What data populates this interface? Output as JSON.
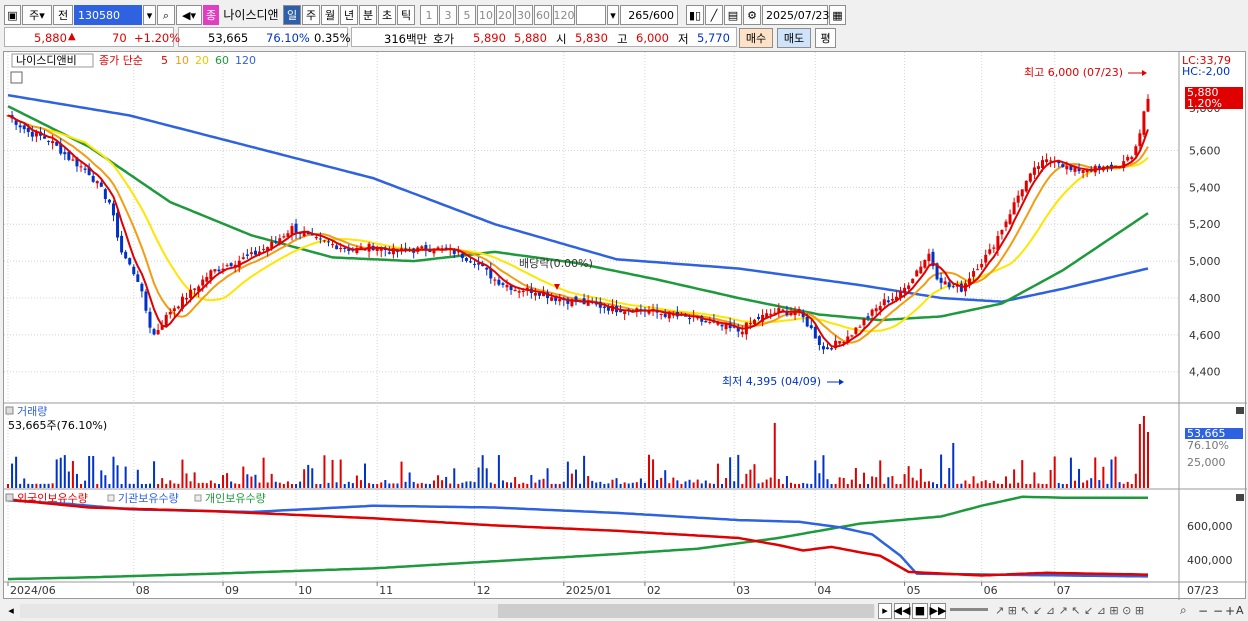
{
  "toolbar": {
    "type_select": "주",
    "mode_select": "전",
    "code": "130580",
    "stock_tag": "종",
    "stock_name": "나이스디앤",
    "periods": [
      "일",
      "주",
      "월",
      "년",
      "분",
      "초",
      "틱"
    ],
    "intervals": [
      "1",
      "3",
      "5",
      "10",
      "20",
      "30",
      "60",
      "120"
    ],
    "count": "265",
    "count_total": "/600",
    "date": "2025/07/23"
  },
  "info": {
    "price": "5,880",
    "arrow": "▲",
    "change": "70",
    "change_pct": "+1.20%",
    "volume": "53,665",
    "vol_ratio": "76.10%",
    "turnover": "0.35%",
    "amount": "316백만",
    "quote_label": "호가",
    "ask": "5,890",
    "bid": "5,880",
    "open_label": "시",
    "open": "5,830",
    "high_label": "고",
    "high": "6,000",
    "low_label": "저",
    "low": "5,770",
    "buy": "매수",
    "sell": "매도",
    "eval": "평"
  },
  "colors": {
    "up": "#e00000",
    "down": "#0032c8",
    "ma5": "#e00000",
    "ma10": "#f39c12",
    "ma20": "#ffe600",
    "ma60": "#1e9a3c",
    "ma120": "#2f62e0",
    "foreign": "#e00000",
    "inst": "#2f62e0",
    "indiv": "#1e9a3c"
  },
  "price_panel": {
    "name_label": "나이스디앤비",
    "legend_prefix": "종가 단순",
    "ma_periods": [
      "5",
      "10",
      "20",
      "60",
      "120"
    ],
    "lc": "LC:33,79",
    "hc": "HC:-2,00",
    "last_price": "5,880",
    "last_pct": "1.20%",
    "cut_label": "5,800",
    "high_note": "최고 6,000 (07/23)",
    "low_note": "최저 4,395 (04/09)",
    "dividend": "배당락(0.00%)"
  },
  "volume_panel": {
    "title": "거래량",
    "sub": "53,665주(76.10%)",
    "last": "53,665",
    "last_pct": "76.10%",
    "tick": "25,000"
  },
  "holdings_panel": {
    "foreign": "외국인보유수량",
    "inst": "기관보유수량",
    "indiv": "개인보유수량",
    "ticks": [
      "600,000",
      "400,000"
    ]
  },
  "x_axis": [
    "2024/06",
    "08",
    "09",
    "10",
    "11",
    "12",
    "2025/01",
    "02",
    "03",
    "04",
    "05",
    "06",
    "07"
  ],
  "x_axis_right": "07/23",
  "chart_data": {
    "type": "line",
    "y_ticks": [
      4400,
      4600,
      4800,
      5000,
      5200,
      5400,
      5600
    ],
    "ylim": [
      4290,
      6080
    ],
    "months": [
      "2024/06",
      "08",
      "09",
      "10",
      "11",
      "12",
      "2025/01",
      "02",
      "03",
      "04",
      "05",
      "06",
      "07"
    ],
    "month_index": [
      0,
      31,
      53,
      71,
      91,
      115,
      137,
      157,
      179,
      199,
      221,
      240,
      258
    ],
    "close_keypoints": [
      [
        0,
        5790
      ],
      [
        5,
        5700
      ],
      [
        10,
        5660
      ],
      [
        15,
        5560
      ],
      [
        20,
        5480
      ],
      [
        25,
        5320
      ],
      [
        28,
        5050
      ],
      [
        32,
        4900
      ],
      [
        35,
        4650
      ],
      [
        36,
        4600
      ],
      [
        40,
        4730
      ],
      [
        45,
        4830
      ],
      [
        50,
        4940
      ],
      [
        55,
        4990
      ],
      [
        60,
        5030
      ],
      [
        65,
        5090
      ],
      [
        70,
        5180
      ],
      [
        75,
        5120
      ],
      [
        80,
        5090
      ],
      [
        85,
        5060
      ],
      [
        90,
        5080
      ],
      [
        95,
        5050
      ],
      [
        100,
        5060
      ],
      [
        105,
        5070
      ],
      [
        110,
        5050
      ],
      [
        115,
        5000
      ],
      [
        120,
        4900
      ],
      [
        125,
        4850
      ],
      [
        130,
        4840
      ],
      [
        135,
        4800
      ],
      [
        140,
        4780
      ],
      [
        145,
        4760
      ],
      [
        150,
        4740
      ],
      [
        155,
        4740
      ],
      [
        160,
        4720
      ],
      [
        165,
        4700
      ],
      [
        170,
        4680
      ],
      [
        175,
        4650
      ],
      [
        180,
        4620
      ],
      [
        185,
        4690
      ],
      [
        190,
        4730
      ],
      [
        195,
        4720
      ],
      [
        198,
        4630
      ],
      [
        201,
        4520
      ],
      [
        204,
        4550
      ],
      [
        208,
        4610
      ],
      [
        212,
        4700
      ],
      [
        216,
        4780
      ],
      [
        220,
        4820
      ],
      [
        224,
        4950
      ],
      [
        227,
        5040
      ],
      [
        229,
        4920
      ],
      [
        232,
        4860
      ],
      [
        235,
        4850
      ],
      [
        238,
        4950
      ],
      [
        242,
        5050
      ],
      [
        246,
        5220
      ],
      [
        250,
        5400
      ],
      [
        254,
        5520
      ],
      [
        258,
        5560
      ],
      [
        262,
        5490
      ],
      [
        265,
        5500
      ],
      [
        270,
        5500
      ],
      [
        274,
        5520
      ],
      [
        277,
        5560
      ],
      [
        279,
        5700
      ],
      [
        280,
        5810
      ],
      [
        281,
        5880
      ]
    ],
    "ma60_keypoints": [
      [
        0,
        5840
      ],
      [
        20,
        5620
      ],
      [
        40,
        5320
      ],
      [
        60,
        5140
      ],
      [
        80,
        5020
      ],
      [
        100,
        5000
      ],
      [
        120,
        5050
      ],
      [
        140,
        4990
      ],
      [
        160,
        4900
      ],
      [
        180,
        4800
      ],
      [
        200,
        4710
      ],
      [
        215,
        4680
      ],
      [
        230,
        4700
      ],
      [
        245,
        4770
      ],
      [
        260,
        4950
      ],
      [
        281,
        5260
      ]
    ],
    "ma120_keypoints": [
      [
        0,
        5900
      ],
      [
        30,
        5790
      ],
      [
        60,
        5620
      ],
      [
        90,
        5450
      ],
      [
        120,
        5200
      ],
      [
        150,
        5010
      ],
      [
        180,
        4960
      ],
      [
        210,
        4870
      ],
      [
        230,
        4800
      ],
      [
        245,
        4780
      ],
      [
        260,
        4850
      ],
      [
        281,
        4960
      ]
    ],
    "foreign_keypoints": [
      [
        0,
        735000
      ],
      [
        20,
        690000
      ],
      [
        50,
        670000
      ],
      [
        90,
        630000
      ],
      [
        120,
        590000
      ],
      [
        150,
        560000
      ],
      [
        180,
        520000
      ],
      [
        190,
        480000
      ],
      [
        196,
        450000
      ],
      [
        203,
        470000
      ],
      [
        210,
        440000
      ],
      [
        215,
        420000
      ],
      [
        222,
        330000
      ],
      [
        240,
        310000
      ],
      [
        250,
        320000
      ],
      [
        256,
        325000
      ],
      [
        281,
        315000
      ]
    ],
    "inst_keypoints": [
      [
        0,
        730000
      ],
      [
        15,
        710000
      ],
      [
        30,
        680000
      ],
      [
        60,
        665000
      ],
      [
        90,
        700000
      ],
      [
        120,
        690000
      ],
      [
        150,
        660000
      ],
      [
        180,
        620000
      ],
      [
        195,
        610000
      ],
      [
        205,
        580000
      ],
      [
        213,
        540000
      ],
      [
        220,
        420000
      ],
      [
        224,
        320000
      ],
      [
        281,
        305000
      ]
    ],
    "indiv_keypoints": [
      [
        0,
        290000
      ],
      [
        20,
        300000
      ],
      [
        50,
        320000
      ],
      [
        90,
        350000
      ],
      [
        120,
        390000
      ],
      [
        150,
        430000
      ],
      [
        170,
        460000
      ],
      [
        190,
        520000
      ],
      [
        210,
        600000
      ],
      [
        230,
        640000
      ],
      [
        240,
        700000
      ],
      [
        250,
        750000
      ],
      [
        260,
        745000
      ],
      [
        281,
        745000
      ]
    ]
  }
}
